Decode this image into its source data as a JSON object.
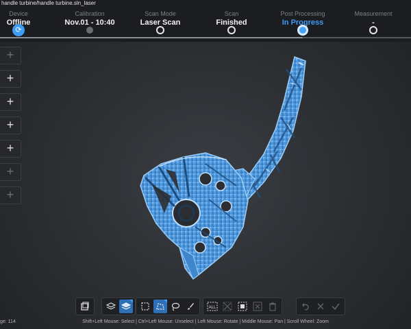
{
  "window": {
    "title": "handle turbine/handle turbine.sln_laser"
  },
  "steps": [
    {
      "label": "Device",
      "value": "Offline",
      "state": "done-first"
    },
    {
      "label": "Calibration",
      "value": "Nov.01 - 10:40",
      "state": "done"
    },
    {
      "label": "Scan Mode",
      "value": "Laser Scan",
      "state": "done"
    },
    {
      "label": "Scan",
      "value": "Finished",
      "state": "done"
    },
    {
      "label": "Post Processing",
      "value": "In Progress",
      "state": "current"
    },
    {
      "label": "Measurement",
      "value": "-",
      "state": "pending"
    }
  ],
  "side_tools": [
    {
      "icon": "plus-icon",
      "glyph": "+",
      "enabled": false
    },
    {
      "icon": "plus-icon",
      "glyph": "+",
      "enabled": true
    },
    {
      "icon": "plus-icon",
      "glyph": "+",
      "enabled": true
    },
    {
      "icon": "plus-icon",
      "glyph": "+",
      "enabled": true
    },
    {
      "icon": "plus-icon",
      "glyph": "+",
      "enabled": true
    },
    {
      "icon": "plus-icon",
      "glyph": "+",
      "enabled": false
    },
    {
      "icon": "plus-icon",
      "glyph": "+",
      "enabled": false
    }
  ],
  "toolbar": {
    "crop_icon": "crop-box-icon",
    "layers_icon": "layers-icon",
    "layers_selected_icon": "layers-selected-icon",
    "rect_select_icon": "rectangle-select-icon",
    "poly_select_icon": "polygon-select-icon",
    "lasso_select_icon": "lasso-select-icon",
    "brush_select_icon": "brush-select-icon",
    "select_all_label": "ALL",
    "invert_icon": "invert-selection-icon",
    "select_connected_icon": "select-connected-icon",
    "deselect_icon": "deselect-icon",
    "delete_icon": "trash-icon",
    "undo_icon": "undo-icon",
    "cancel_icon": "cancel-icon",
    "apply_icon": "apply-check-icon"
  },
  "status": {
    "left": "ge: 114",
    "hint": "Shift+Left Mouse: Select | Ctrl+Left Mouse: Unselect | Left Mouse: Rotate | Middle Mouse: Pan | Scroll Wheel: Zoom"
  },
  "colors": {
    "accent": "#3d9cf5",
    "model_fill": "#4a96dd",
    "model_light": "#8cc4f5",
    "model_dark": "#2a5f94",
    "toolbar_active": "#2f6fb6"
  }
}
